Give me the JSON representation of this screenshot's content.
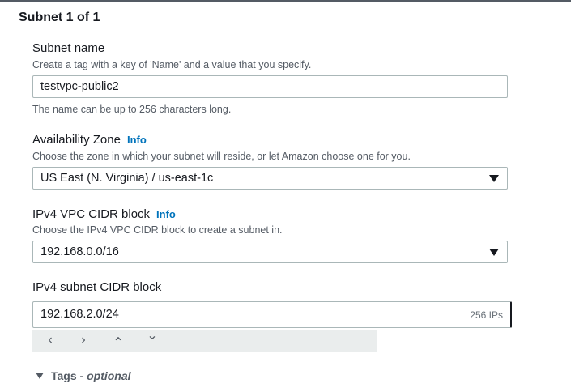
{
  "section": {
    "title": "Subnet 1 of 1"
  },
  "subnet_name": {
    "label": "Subnet name",
    "description": "Create a tag with a key of 'Name' and a value that you specify.",
    "value": "testvpc-public2",
    "hint": "The name can be up to 256 characters long."
  },
  "availability_zone": {
    "label": "Availability Zone",
    "info": "Info",
    "description": "Choose the zone in which your subnet will reside, or let Amazon choose one for you.",
    "selected": "US East (N. Virginia) / us-east-1c"
  },
  "vpc_cidr": {
    "label": "IPv4 VPC CIDR block",
    "info": "Info",
    "description": "Choose the IPv4 VPC CIDR block to create a subnet in.",
    "selected": "192.168.0.0/16"
  },
  "subnet_cidr": {
    "label": "IPv4 subnet CIDR block",
    "value": "192.168.2.0/24",
    "suffix": "256 IPs",
    "stepper": {
      "prev": "‹",
      "next": "›",
      "up": "⌃",
      "down": "⌄"
    }
  },
  "tags": {
    "label": "Tags -",
    "optional": "optional"
  }
}
